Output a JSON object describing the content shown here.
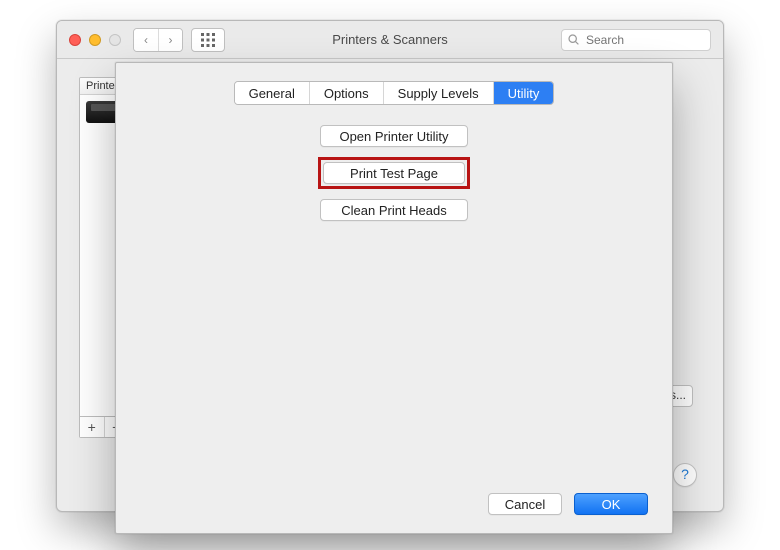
{
  "parent_window": {
    "title": "Printers & Scanners",
    "search_placeholder": "Search",
    "printer_list_header": "Printer",
    "add_label": "+",
    "remove_label": "−",
    "peeking_button_suffix": "s...",
    "help_label": "?"
  },
  "sheet": {
    "tabs": {
      "general": "General",
      "options": "Options",
      "supply_levels": "Supply Levels",
      "utility": "Utility"
    },
    "active_tab": "utility",
    "actions": {
      "open_utility": "Open Printer Utility",
      "print_test_page": "Print Test Page",
      "clean_heads": "Clean Print Heads"
    },
    "footer": {
      "cancel": "Cancel",
      "ok": "OK"
    }
  }
}
